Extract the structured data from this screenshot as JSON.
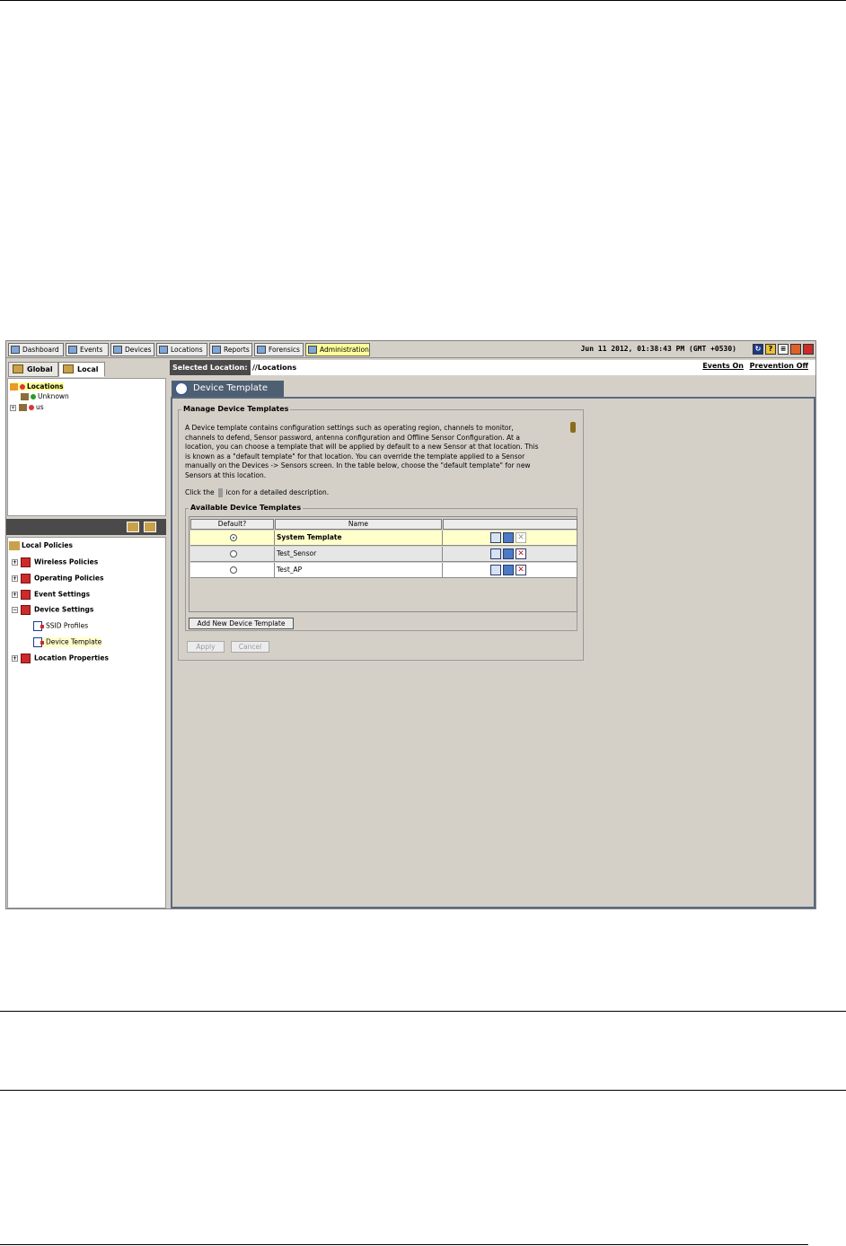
{
  "menubar": {
    "tabs": [
      {
        "label": "Dashboard",
        "icon": "dashboard-icon"
      },
      {
        "label": "Events",
        "icon": "events-icon"
      },
      {
        "label": "Devices",
        "icon": "devices-icon"
      },
      {
        "label": "Locations",
        "icon": "locations-icon"
      },
      {
        "label": "Reports",
        "icon": "reports-icon"
      },
      {
        "label": "Forensics",
        "icon": "forensics-icon"
      },
      {
        "label": "Administration",
        "icon": "administration-icon",
        "active": true
      }
    ],
    "datetime": "Jun 11 2012, 01:38:43 PM (GMT +0530)",
    "tool_icons": [
      "refresh-icon",
      "help-icon",
      "list-icon",
      "settings-icon",
      "logout-icon"
    ]
  },
  "left": {
    "tabs": [
      "Global",
      "Local"
    ],
    "location_tree": [
      {
        "label": "Locations"
      },
      {
        "label": "Unknown"
      },
      {
        "label": "us"
      }
    ],
    "policy_root": "Local Policies",
    "policies": [
      {
        "label": "Wireless Policies"
      },
      {
        "label": "Operating Policies"
      },
      {
        "label": "Event Settings"
      },
      {
        "label": "Device Settings"
      },
      {
        "label": "SSID Profiles"
      },
      {
        "label": "Device Template"
      },
      {
        "label": "Location Properties"
      }
    ]
  },
  "location_bar": {
    "label": "Selected Location:",
    "path": "//Locations",
    "events_link": "Events On",
    "prevention_link": "Prevention Off"
  },
  "page_tab": "Device Template",
  "manage": {
    "legend": "Manage Device Templates",
    "description": "A Device template contains configuration settings such as operating region, channels to monitor, channels to defend, Sensor password, antenna configuration and Offline Sensor Configuration. At a location, you can choose a template that will be applied by default to a new Sensor at that location. This is known as a \"default template\" for that location. You can override the template applied to a Sensor manually on the Devices -> Sensors screen. In the table below, choose the \"default template\" for new Sensors at this location.",
    "click_prefix": "Click the",
    "click_suffix": "icon for a detailed description.",
    "available_legend": "Available Device Templates",
    "columns": [
      "Default?",
      "Name",
      ""
    ],
    "rows": [
      {
        "name": "System Template",
        "default": true
      },
      {
        "name": "Test_Sensor",
        "default": false
      },
      {
        "name": "Test_AP",
        "default": false
      }
    ],
    "add_button": "Add New Device Template",
    "apply_button": "Apply",
    "cancel_button": "Cancel"
  }
}
